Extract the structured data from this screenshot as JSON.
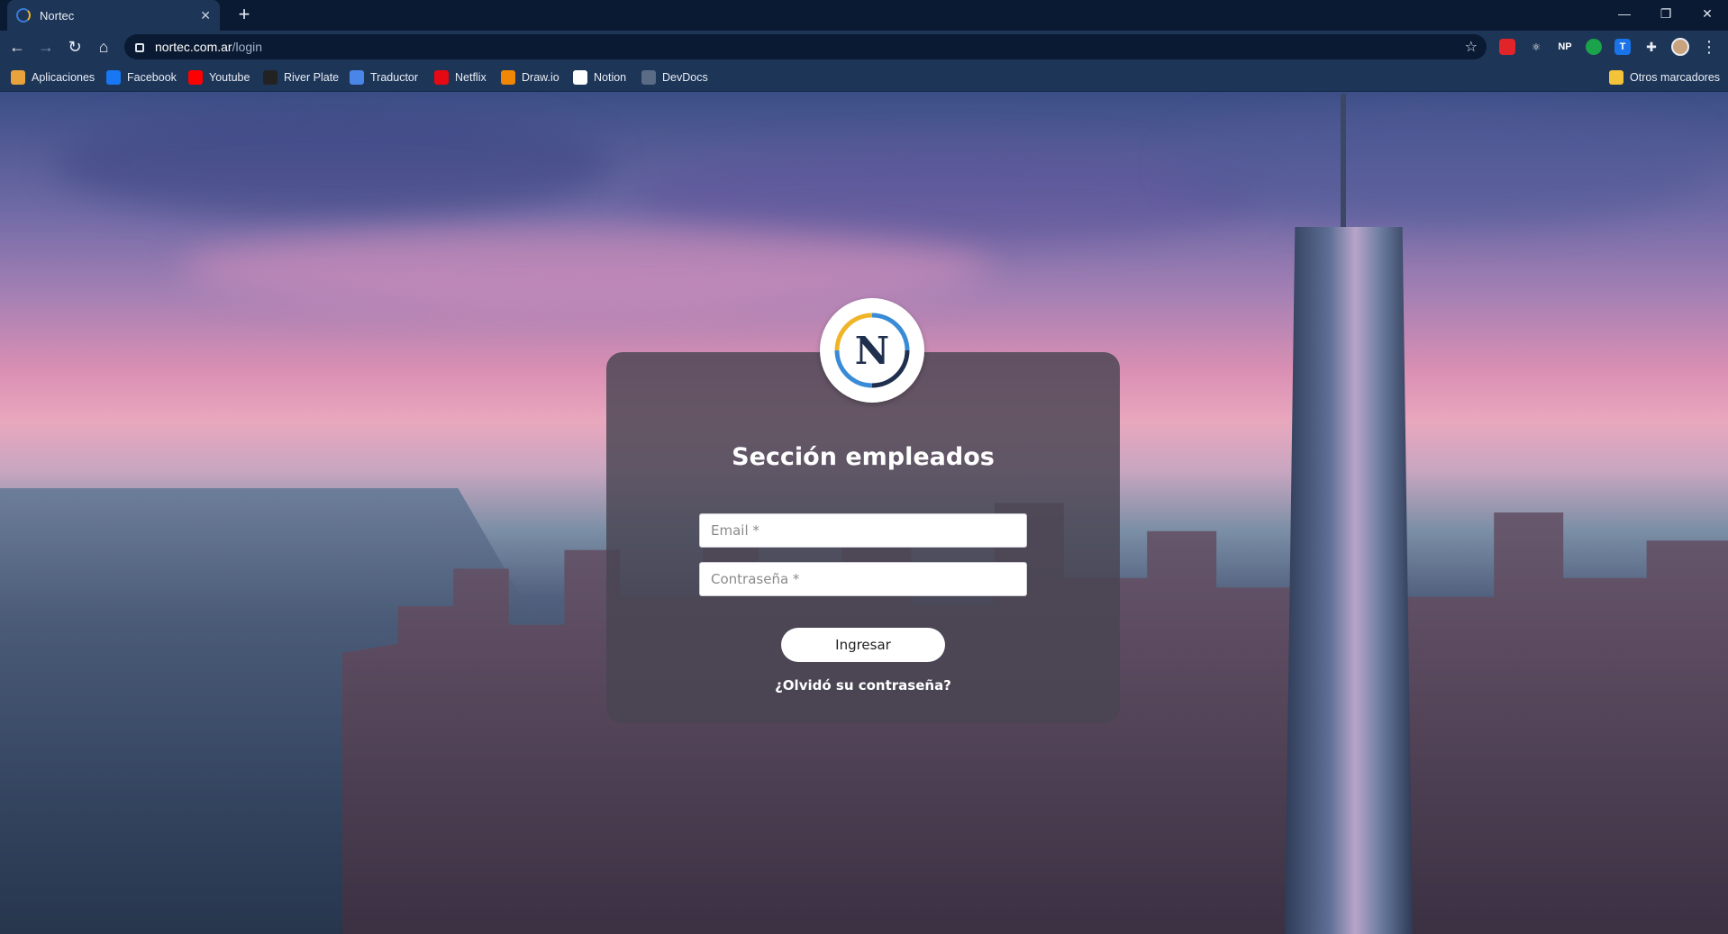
{
  "browser": {
    "tab": {
      "title": "Nortec"
    },
    "address": {
      "host": "nortec.com.ar",
      "path": "/login"
    },
    "bookmarks": [
      {
        "label": "Aplicaciones",
        "icon": "apps-grid-icon",
        "color": "#e8a33d"
      },
      {
        "label": "Facebook",
        "icon": "facebook-icon",
        "color": "#1877f2"
      },
      {
        "label": "Youtube",
        "icon": "youtube-icon",
        "color": "#ff0000"
      },
      {
        "label": "River Plate",
        "icon": "river-plate-icon",
        "color": "#222222"
      },
      {
        "label": "Traductor",
        "icon": "translate-icon",
        "color": "#4a86e8"
      },
      {
        "label": "Netflix",
        "icon": "netflix-icon",
        "color": "#e50914"
      },
      {
        "label": "Draw.io",
        "icon": "drawio-icon",
        "color": "#f08705"
      },
      {
        "label": "Notion",
        "icon": "notion-icon",
        "color": "#ffffff"
      },
      {
        "label": "DevDocs",
        "icon": "devdocs-icon",
        "color": "#5a6b85"
      }
    ],
    "other_bookmarks": "Otros marcadores",
    "extensions": [
      {
        "name": "adblock-icon",
        "color": "#e0242a"
      },
      {
        "name": "react-devtools-icon",
        "color": "#1d3557"
      },
      {
        "name": "np-icon",
        "color": "#1d3557",
        "text": "NP"
      },
      {
        "name": "green-extension-icon",
        "color": "#1aa34a"
      },
      {
        "name": "t-extension-icon",
        "color": "#1a73e8",
        "text": "T"
      }
    ]
  },
  "login": {
    "logo_letter": "N",
    "title": "Sección empleados",
    "email_placeholder": "Email *",
    "password_placeholder": "Contraseña *",
    "submit_label": "Ingresar",
    "forgot_label": "¿Olvidó su contraseña?"
  }
}
